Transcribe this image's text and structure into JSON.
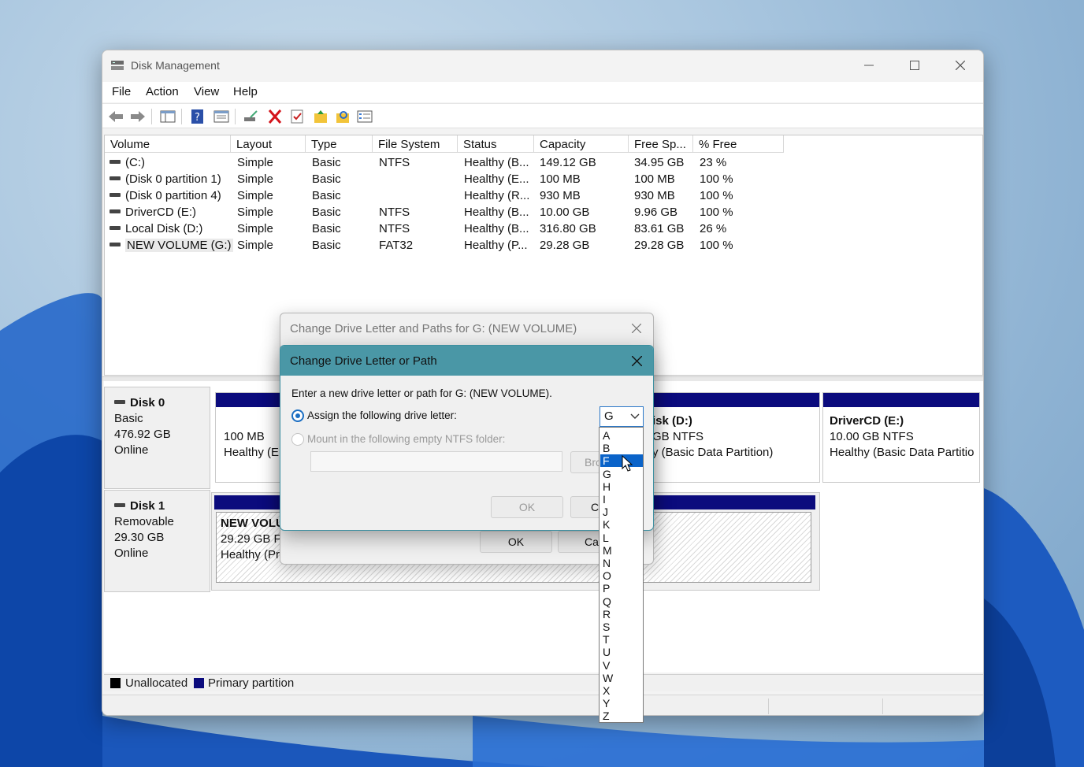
{
  "window": {
    "title": "Disk Management",
    "menu": [
      "File",
      "Action",
      "View",
      "Help"
    ]
  },
  "volume_table": {
    "columns": [
      "Volume",
      "Layout",
      "Type",
      "File System",
      "Status",
      "Capacity",
      "Free Sp...",
      "% Free"
    ],
    "rows": [
      [
        "(C:)",
        "Simple",
        "Basic",
        "NTFS",
        "Healthy (B...",
        "149.12 GB",
        "34.95 GB",
        "23 %"
      ],
      [
        "(Disk 0 partition 1)",
        "Simple",
        "Basic",
        "",
        "Healthy (E...",
        "100 MB",
        "100 MB",
        "100 %"
      ],
      [
        "(Disk 0 partition 4)",
        "Simple",
        "Basic",
        "",
        "Healthy (R...",
        "930 MB",
        "930 MB",
        "100 %"
      ],
      [
        "DriverCD (E:)",
        "Simple",
        "Basic",
        "NTFS",
        "Healthy (B...",
        "10.00 GB",
        "9.96 GB",
        "100 %"
      ],
      [
        "Local Disk (D:)",
        "Simple",
        "Basic",
        "NTFS",
        "Healthy (B...",
        "316.80 GB",
        "83.61 GB",
        "26 %"
      ],
      [
        "NEW VOLUME (G:)",
        "Simple",
        "Basic",
        "FAT32",
        "Healthy (P...",
        "29.28 GB",
        "29.28 GB",
        "100 %"
      ]
    ]
  },
  "disks": {
    "disk0": {
      "name": "Disk 0",
      "type": "Basic",
      "size": "476.92 GB",
      "status": "Online"
    },
    "disk1": {
      "name": "Disk 1",
      "type": "Removable",
      "size": "29.30 GB",
      "status": "Online"
    }
  },
  "partitions": {
    "d0p1": {
      "line1": "100 MB",
      "line2": "Healthy (EF"
    },
    "d0local": {
      "title": "isk  (D:)",
      "line1": "GB NTFS",
      "line2": "y (Basic Data Partition)"
    },
    "d0driver": {
      "title": "DriverCD  (E:)",
      "line1": "10.00 GB NTFS",
      "line2": "Healthy (Basic Data Partitio"
    },
    "d1new": {
      "title": "NEW VOLU",
      "line1": "29.29 GB FA",
      "line2": "Healthy (Pri"
    }
  },
  "legend": {
    "unallocated": "Unallocated",
    "primary": "Primary partition"
  },
  "dialog_back": {
    "title": "Change Drive Letter and Paths for G: (NEW VOLUME)",
    "ok": "OK",
    "cancel_partial": "Ca"
  },
  "dialog_front": {
    "title": "Change Drive Letter or Path",
    "instruction": "Enter a new drive letter or path for G: (NEW VOLUME).",
    "assign_label": "Assign the following drive letter:",
    "mount_label": "Mount in the following empty NTFS folder:",
    "browse_partial": "Bro",
    "ok": "OK",
    "cancel_partial": "C",
    "selected_letter": "G",
    "dropdown_letters": [
      "A",
      "B",
      "F",
      "G",
      "H",
      "I",
      "J",
      "K",
      "L",
      "M",
      "N",
      "O",
      "P",
      "Q",
      "R",
      "S",
      "T",
      "U",
      "V",
      "W",
      "X",
      "Y",
      "Z"
    ],
    "highlighted_letter": "F"
  },
  "colors": {
    "primary_partition": "#0b0b7d",
    "accent": "#1b6ec2",
    "dialog_header": "#4a97a6"
  }
}
